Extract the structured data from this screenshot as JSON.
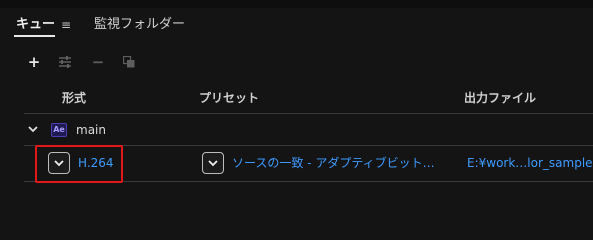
{
  "tabs": {
    "queue_label": "キュー",
    "menu_glyph": "≡",
    "watch_label": "監視フォルダー"
  },
  "toolbar": {
    "add_glyph": "+",
    "settings_glyph": "⚌",
    "remove_glyph": "−",
    "duplicate_glyph": "⧉"
  },
  "columns": {
    "format": "形式",
    "preset": "プリセット",
    "output": "出力ファイル"
  },
  "group": {
    "app_badge": "Ae",
    "name": "main"
  },
  "item": {
    "format": "H.264",
    "preset": "ソースの一致 - アダプティブビット…",
    "output": "E:¥work…lor_sample"
  },
  "colors": {
    "background": "#141414",
    "link": "#3d9bff",
    "highlight": "#e01818"
  }
}
